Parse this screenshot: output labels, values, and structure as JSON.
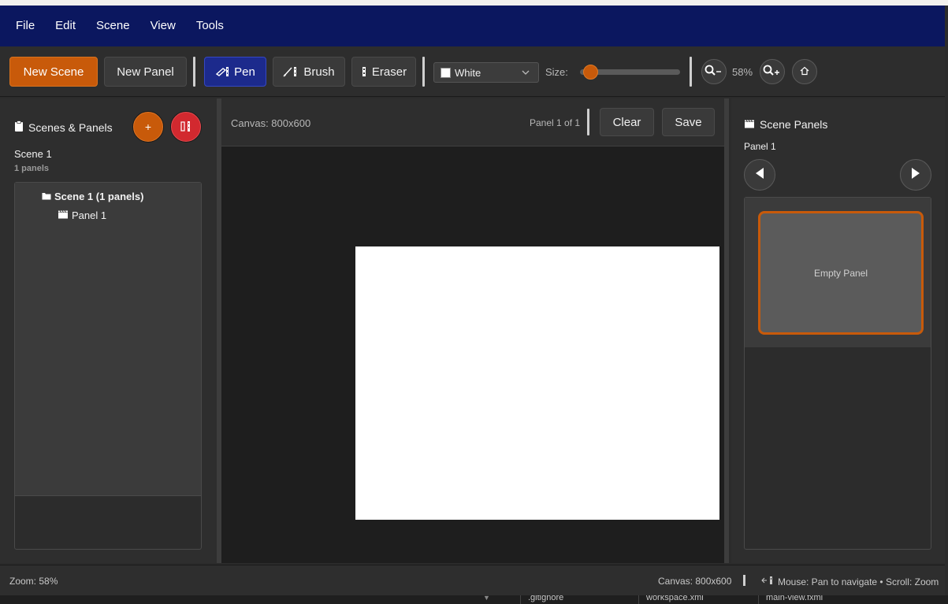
{
  "menubar": {
    "items": [
      "File",
      "Edit",
      "Scene",
      "View",
      "Tools"
    ]
  },
  "toolbar": {
    "new_scene": "New Scene",
    "new_panel": "New Panel",
    "pen": "Pen",
    "brush": "Brush",
    "eraser": "Eraser",
    "color_select": "White",
    "size_label": "Size:",
    "size_value": 0.05,
    "zoom_value": "58%",
    "active_tool": "pen"
  },
  "left_panel": {
    "title": "Scenes & Panels",
    "add_label": "+",
    "scene_name": "Scene 1",
    "scene_count": "1 panels",
    "tree": {
      "scene_label": "Scene 1 (1 panels)",
      "panel_label": "Panel 1"
    }
  },
  "center": {
    "canvas_info": "Canvas: 800x600",
    "panel_info": "Panel 1 of 1",
    "clear": "Clear",
    "save": "Save"
  },
  "right_panel": {
    "title": "Scene Panels",
    "current_panel": "Panel 1",
    "thumbnail_label": "Empty Panel"
  },
  "statusbar": {
    "zoom": "Zoom: 58%",
    "canvas": "Canvas: 800x600",
    "hint": "Mouse: Pan to navigate • Scroll: Zoom"
  },
  "ide_tabs": [
    ".gitignore",
    "workspace.xml",
    "main-view.fxml"
  ],
  "colors": {
    "menubar": "#0b175f",
    "accent_orange": "#c85a0a",
    "active_tool": "#1c2a8c",
    "delete_red": "#d2292f"
  }
}
